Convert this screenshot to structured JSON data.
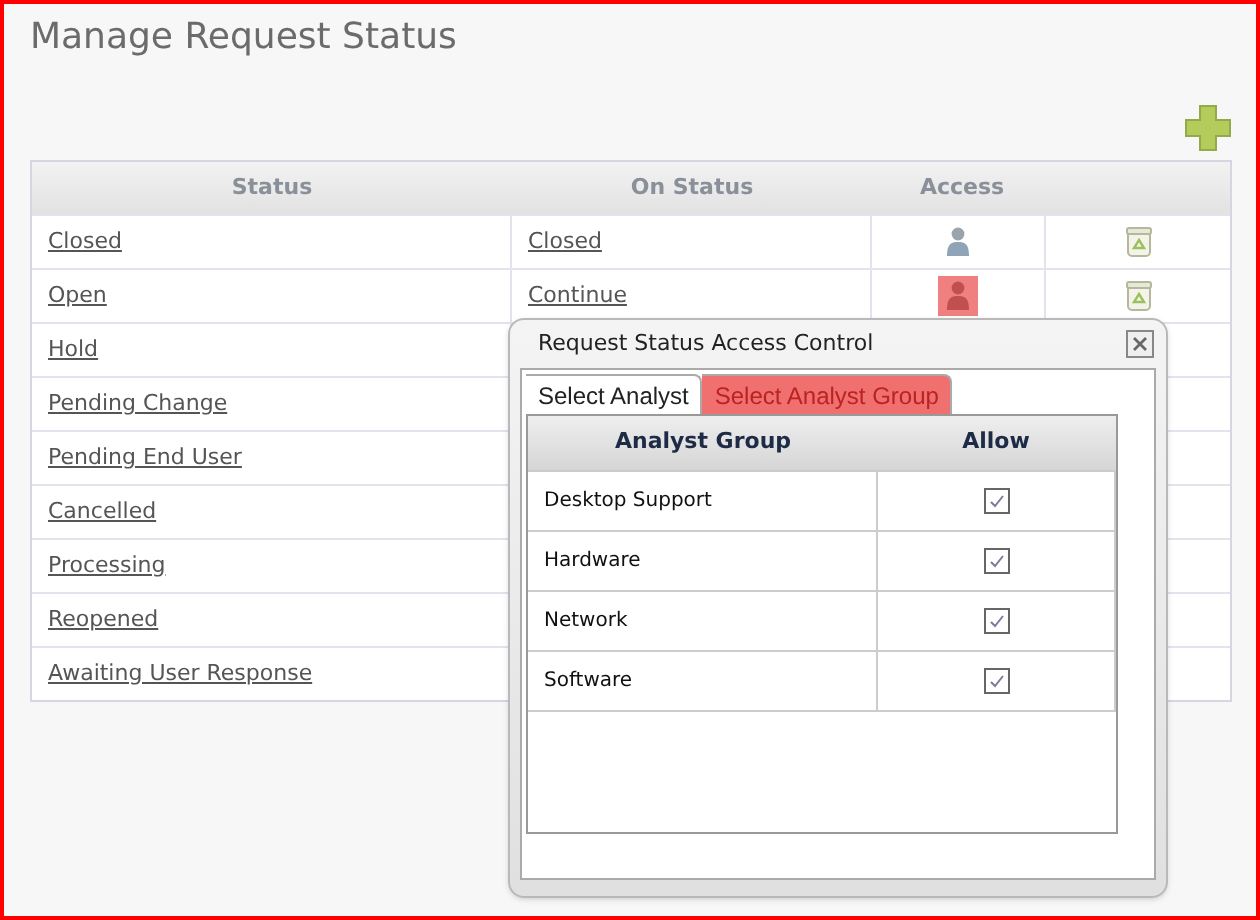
{
  "page": {
    "title": "Manage Request Status"
  },
  "table": {
    "columns": [
      "Status",
      "On Status",
      "Access"
    ],
    "rows": [
      {
        "status": "Closed",
        "on_status": "Closed",
        "access_highlighted": false
      },
      {
        "status": "Open",
        "on_status": "Continue",
        "access_highlighted": true
      },
      {
        "status": "Hold"
      },
      {
        "status": "Pending Change"
      },
      {
        "status": "Pending End User"
      },
      {
        "status": "Cancelled"
      },
      {
        "status": "Processing"
      },
      {
        "status": "Reopened"
      },
      {
        "status": "Awaiting User Response"
      }
    ]
  },
  "dialog": {
    "title": "Request Status Access Control",
    "tabs": [
      {
        "label": "Select Analyst",
        "selected": false
      },
      {
        "label": "Select Analyst Group",
        "selected": true
      }
    ],
    "columns": [
      "Analyst Group",
      "Allow"
    ],
    "rows": [
      {
        "name": "Desktop Support",
        "checked": true
      },
      {
        "name": "Hardware",
        "checked": true
      },
      {
        "name": "Network",
        "checked": true
      },
      {
        "name": "Software",
        "checked": true
      }
    ]
  }
}
